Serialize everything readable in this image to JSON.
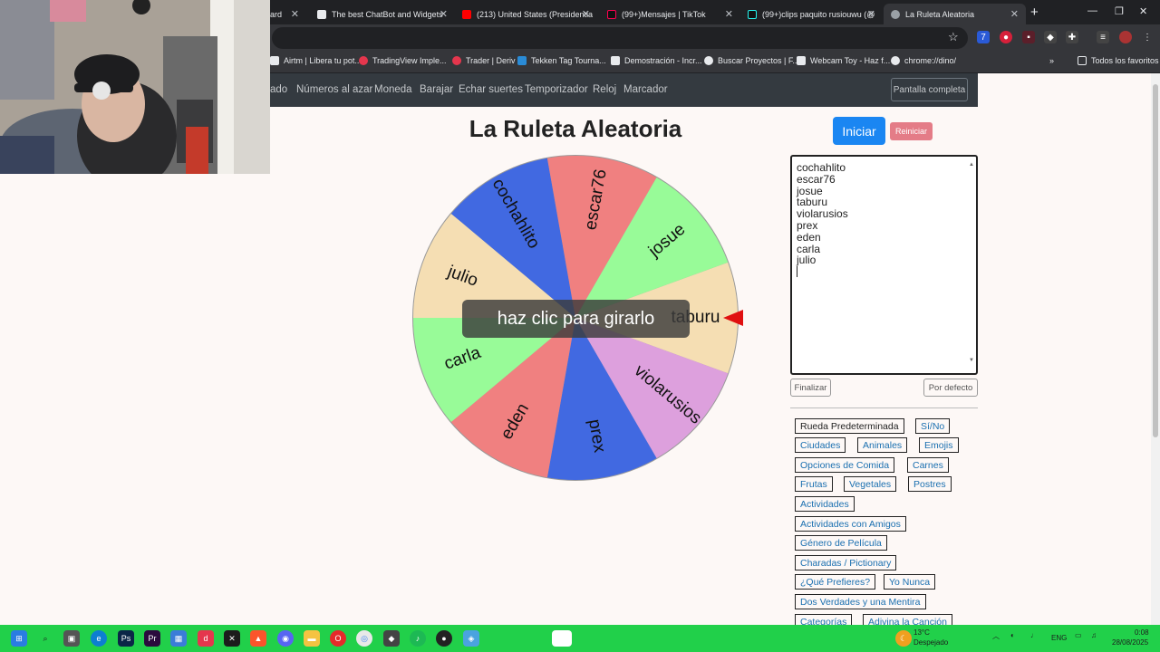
{
  "browser": {
    "tabs": [
      {
        "label": "ard",
        "color": "#5f6368"
      },
      {
        "label": "The best ChatBot and Widgets",
        "color": "#e8eaed"
      },
      {
        "label": "(213) United States (Presidentia",
        "color": "#ff0000"
      },
      {
        "label": "(99+)Mensajes | TikTok",
        "color": "#111111"
      },
      {
        "label": "(99+)clips paquito rusiouwu (@",
        "color": "#111111"
      },
      {
        "label": "La Ruleta Aleatoria",
        "color": "#9aa0a6"
      }
    ],
    "new_tab": "+",
    "bookmarks": [
      {
        "label": "Airtm | Libera tu pot...",
        "color": "#e8eaed"
      },
      {
        "label": "TradingView Imple...",
        "color": "#e5364d"
      },
      {
        "label": "Trader | Deriv",
        "color": "#e5364d"
      },
      {
        "label": "Tekken Tag Tourna...",
        "color": "#2a8bd6"
      },
      {
        "label": "Demostración - Incr...",
        "color": "#e8eaed"
      },
      {
        "label": "Buscar Proyectos | F...",
        "color": "#e8eaed"
      },
      {
        "label": "Webcam Toy - Haz f...",
        "color": "#e8eaed"
      },
      {
        "label": "chrome://dino/",
        "color": "#e8eaed"
      }
    ],
    "all_favorites": "Todos los favoritos"
  },
  "nav": {
    "links": [
      "ado",
      "Números al azar",
      "Moneda",
      "Barajar",
      "Echar suertes",
      "Temporizador",
      "Reloj",
      "Marcador"
    ],
    "fullscreen": "Pantalla completa"
  },
  "main": {
    "title": "La Ruleta Aleatoria",
    "start": "Iniciar",
    "reset": "Reiniciar",
    "spin_hint": "haz clic para girarlo",
    "finish": "Finalizar",
    "default": "Por defecto"
  },
  "wheel": {
    "segments": [
      {
        "name": "taburu",
        "color": "#f5deb3"
      },
      {
        "name": "violarusios",
        "color": "#dda0dd"
      },
      {
        "name": "prex",
        "color": "#4169e1"
      },
      {
        "name": "eden",
        "color": "#f08080"
      },
      {
        "name": "carla",
        "color": "#98fb98"
      },
      {
        "name": "julio",
        "color": "#f5deb3"
      },
      {
        "name": "cochahlito",
        "color": "#4169e1"
      },
      {
        "name": "escar76",
        "color": "#f08080"
      },
      {
        "name": "josue",
        "color": "#98fb98"
      }
    ]
  },
  "names_list": [
    "cochahlito",
    "escar76",
    "josue",
    "taburu",
    "violarusios",
    "prex",
    "eden",
    "carla",
    "julio"
  ],
  "presets": [
    "Rueda Predeterminada",
    "Sí/No",
    "Ciudades",
    "Animales",
    "Emojis",
    "Opciones de Comida",
    "Carnes",
    "Frutas",
    "Vegetales",
    "Postres",
    "Actividades",
    "Actividades con Amigos",
    "Género de Película",
    "Charadas / Pictionary",
    "¿Qué Prefieres?",
    "Yo Nunca",
    "Dos Verdades y una Mentira",
    "Categorías",
    "Adivina la Canción"
  ],
  "taskbar": {
    "weather_temp": "13°C",
    "weather_desc": "Despejado",
    "lang": "ENG",
    "time": "0:08",
    "date": "28/08/2025"
  }
}
